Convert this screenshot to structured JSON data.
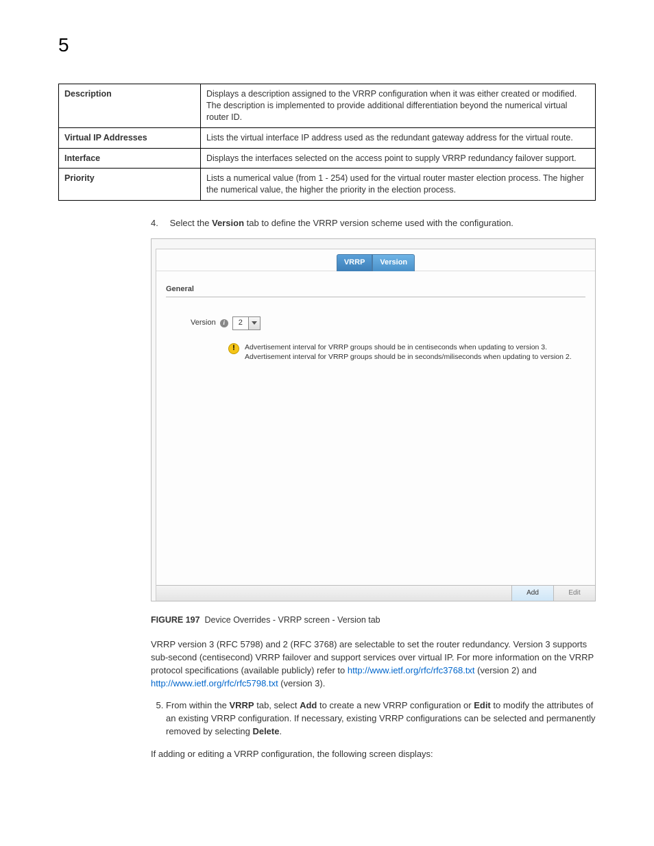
{
  "chapterNumber": "5",
  "table": {
    "rows": [
      {
        "label": "Description",
        "text": "Displays a description assigned to the VRRP configuration when it was either created or modified. The description is implemented to provide additional differentiation beyond the numerical virtual router ID."
      },
      {
        "label": "Virtual IP Addresses",
        "text": "Lists the virtual interface IP address used as the redundant gateway address for the virtual route."
      },
      {
        "label": "Interface",
        "text": "Displays the interfaces selected on the access point to supply VRRP redundancy failover support."
      },
      {
        "label": "Priority",
        "text": "Lists a numerical value (from 1 - 254) used for the virtual router master election process. The higher the numerical value, the higher the priority in the election process."
      }
    ]
  },
  "step4_pre": "Select the ",
  "step4_bold": "Version",
  "step4_post": " tab to define the VRRP version scheme used with the configuration.",
  "panel": {
    "tabs": {
      "vrrp": "VRRP",
      "version": "Version"
    },
    "generalLabel": "General",
    "versionLabel": "Version",
    "versionValue": "2",
    "warningLine1": "Advertisement interval for VRRP groups should be in centiseconds when updating to version 3.",
    "warningLine2": "Advertisement interval for VRRP groups should be in seconds/miliseconds when updating to version 2.",
    "addBtn": "Add",
    "editBtn": "Edit"
  },
  "figure": {
    "num": "FIGURE 197",
    "caption": "Device Overrides - VRRP screen - Version tab"
  },
  "para1_a": "VRRP version 3 (RFC 5798) and 2 (RFC 3768) are selectable to set the router redundancy. Version 3 supports sub-second (centisecond) VRRP failover and support services over virtual IP. For more information on the VRRP protocol specifications (available publicly) refer to ",
  "para1_link1": "http://www.ietf.org/rfc/rfc3768.txt",
  "para1_b": " (version 2) and ",
  "para1_link2": "http://www.ietf.org/rfc/rfc5798.txt",
  "para1_c": " (version 3).",
  "step5_a": "From within the ",
  "step5_b1": "VRRP",
  "step5_c": " tab, select ",
  "step5_b2": "Add",
  "step5_d": " to create a new VRRP configuration or ",
  "step5_b3": "Edit",
  "step5_e": " to modify the attributes of an existing VRRP configuration. If necessary, existing VRRP configurations can be selected and permanently removed by selecting ",
  "step5_b4": "Delete",
  "step5_f": ".",
  "para2": "If adding or editing a VRRP configuration, the following screen displays:"
}
